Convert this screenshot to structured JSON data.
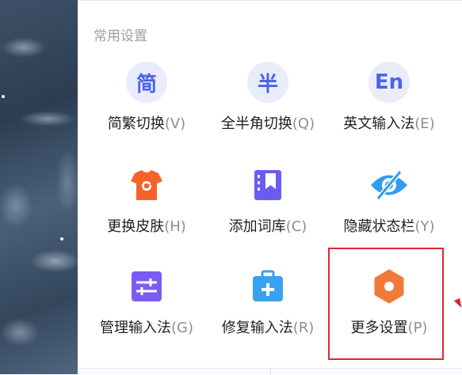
{
  "section": {
    "title": "常用设置"
  },
  "items": [
    {
      "icon_text": "简",
      "label": "简繁切换",
      "shortcut": "(V)"
    },
    {
      "icon_text": "半",
      "label": "全半角切换",
      "shortcut": "(Q)"
    },
    {
      "icon_text": "En",
      "label": "英文输入法",
      "shortcut": "(E)"
    },
    {
      "icon": "skin-shirt-icon",
      "label": "更换皮肤",
      "shortcut": "(H)"
    },
    {
      "icon": "dictionary-icon",
      "label": "添加词库",
      "shortcut": "(C)"
    },
    {
      "icon": "hidden-eye-icon",
      "label": "隐藏状态栏",
      "shortcut": "(Y)"
    },
    {
      "icon": "sliders-icon",
      "label": "管理输入法",
      "shortcut": "(G)"
    },
    {
      "icon": "repair-kit-icon",
      "label": "修复输入法",
      "shortcut": "(R)"
    },
    {
      "icon": "hexagon-gear-icon",
      "label": "更多设置",
      "shortcut": "(P)"
    }
  ],
  "colors": {
    "accent_blue": "#4a63e8",
    "skin_orange": "#f5632a",
    "dictionary_purple": "#6a5cf0",
    "eye_blue": "#2f9cf0",
    "sliders_purple": "#7a5cf2",
    "repair_blue": "#3aa0f0",
    "more_orange": "#f07a3a",
    "highlight_red": "#e0282e"
  }
}
